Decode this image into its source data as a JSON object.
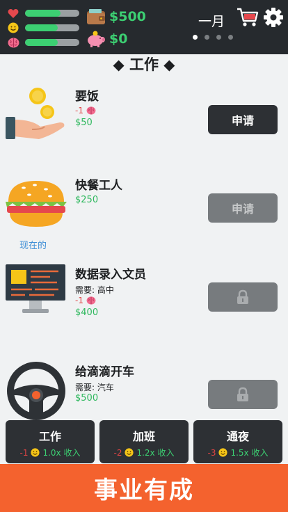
{
  "stats": {
    "health": 0.66,
    "happiness": 0.6,
    "smarts": 0.6
  },
  "money": {
    "wallet": "$500",
    "savings": "$0"
  },
  "month": "一月",
  "pager": {
    "count": 4,
    "active": 0
  },
  "section_title": "◆ 工作 ◆",
  "jobs": [
    {
      "title": "要饭",
      "req": "",
      "cost": "-1",
      "salary": "$50",
      "current": "",
      "button": "申请",
      "state": "active"
    },
    {
      "title": "快餐工人",
      "req": "",
      "cost": "",
      "salary": "$250",
      "current": "现在的",
      "button": "申请",
      "state": "disabled"
    },
    {
      "title": "数据录入文员",
      "req": "需要: 高中",
      "cost": "-1",
      "salary": "$400",
      "current": "",
      "button": "",
      "state": "locked"
    },
    {
      "title": "给滴滴开车",
      "req": "需要: 汽车",
      "cost": "",
      "salary": "$500",
      "current": "",
      "button": "",
      "state": "locked"
    }
  ],
  "modes": [
    {
      "title": "工作",
      "cost": "-1",
      "mult": "1.0x 收入"
    },
    {
      "title": "加班",
      "cost": "-2",
      "mult": "1.2x 收入"
    },
    {
      "title": "通夜",
      "cost": "-3",
      "mult": "1.5x 收入"
    }
  ],
  "banner": "事业有成",
  "colors": {
    "accent": "#3ccf72",
    "banner": "#f4622e",
    "topbar": "#262a2e",
    "loss": "#e04444",
    "current": "#3f8fd6"
  }
}
